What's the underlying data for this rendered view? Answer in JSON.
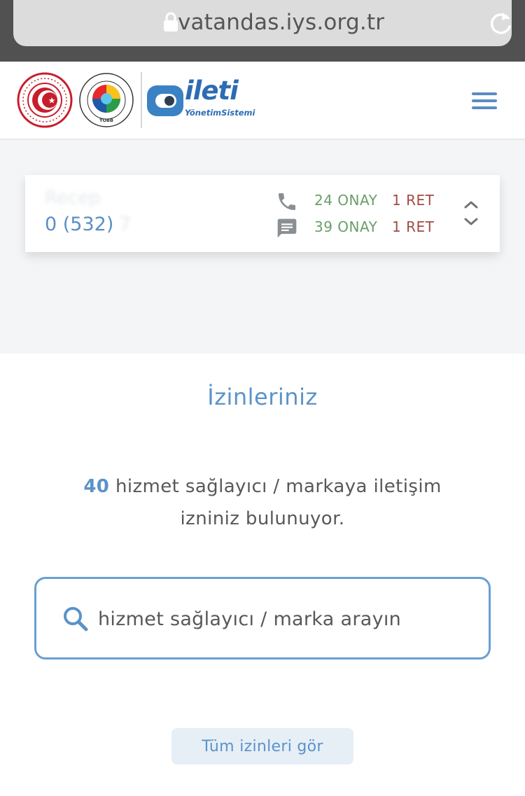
{
  "browser": {
    "url": "vatandas.iys.org.tr"
  },
  "header": {
    "brand_name": "ileti",
    "brand_subtitle": "YönetimSistemi",
    "tobb_text": "TOBB",
    "tobb_ring_text": "TÜRKİYE ODALAR VE BORSALAR BİRLİĞİ"
  },
  "user_card": {
    "name": "Recep",
    "phone_prefix": "0 (532)",
    "phone_rest": "7",
    "call": {
      "approve": "24 ONAY",
      "reject": "1 RET"
    },
    "sms": {
      "approve": "39 ONAY",
      "reject": "1 RET"
    }
  },
  "permissions": {
    "title": "İzinleriniz",
    "count": "40",
    "count_text_line1": "hizmet sağlayıcı / markaya iletişim",
    "count_text_line2": "izniniz bulunuyor.",
    "search_placeholder": "hizmet sağlayıcı / marka arayın",
    "all_button_label": "Tüm izinleri gör"
  },
  "colors": {
    "accent": "#5b93c9",
    "approve": "#6a9e68",
    "reject": "#a24a43"
  }
}
